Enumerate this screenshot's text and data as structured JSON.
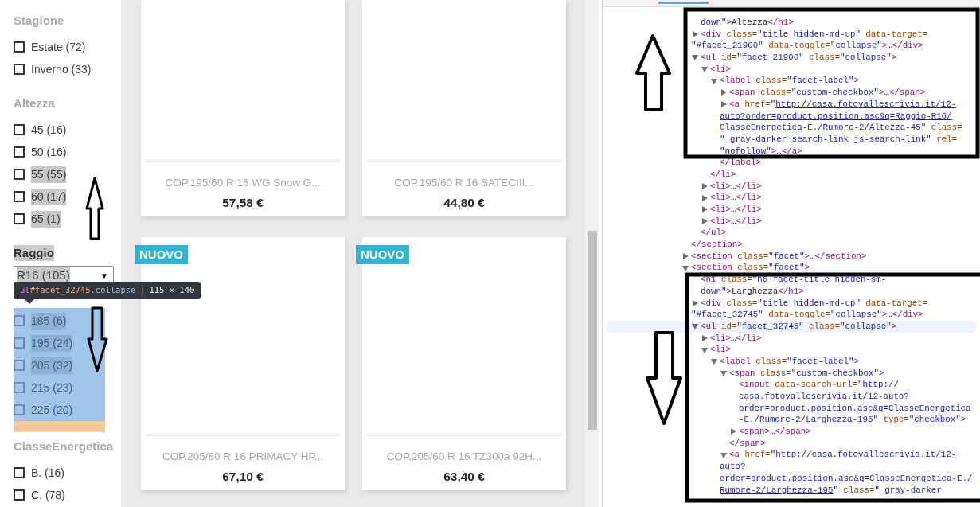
{
  "sidebar": {
    "facets": [
      {
        "kind": "checkbox",
        "title": "Stagione",
        "title_highlighted": false,
        "items": [
          {
            "label": "Estate (72)",
            "checked": false,
            "highlighted": false
          },
          {
            "label": "Inverno (33)",
            "checked": false,
            "highlighted": false
          }
        ]
      },
      {
        "kind": "checkbox",
        "title": "Altezza",
        "title_highlighted": false,
        "items": [
          {
            "label": "45 (16)",
            "checked": false,
            "highlighted": false
          },
          {
            "label": "50 (16)",
            "checked": false,
            "highlighted": false
          },
          {
            "label": "55 (55)",
            "checked": false,
            "highlighted": true
          },
          {
            "label": "60 (17)",
            "checked": false,
            "highlighted": true
          },
          {
            "label": "65 (1)",
            "checked": false,
            "highlighted": true
          }
        ]
      },
      {
        "kind": "select",
        "title": "Raggio",
        "title_highlighted": true,
        "value": "R16 (105)",
        "value_highlighted": true,
        "caret": "▼"
      },
      {
        "kind": "checkbox",
        "inspected": true,
        "tooltip": {
          "tag": "ul",
          "id": "#facet_32745",
          "class": ".collapse",
          "size": "115 × 140"
        },
        "items": [
          {
            "label": "185 (6)",
            "checked": false,
            "highlighted": true
          },
          {
            "label": "195 (24)",
            "checked": false,
            "highlighted": true
          },
          {
            "label": "205 (32)",
            "checked": false,
            "highlighted": true
          },
          {
            "label": "215 (23)",
            "checked": false,
            "highlighted": false
          },
          {
            "label": "225 (20)",
            "checked": false,
            "highlighted": false
          }
        ]
      },
      {
        "kind": "checkbox",
        "title": "ClasseEnergetica",
        "title_highlighted": false,
        "items": [
          {
            "label": "B. (16)",
            "checked": false,
            "highlighted": false
          },
          {
            "label": "C. (78)",
            "checked": false,
            "highlighted": false
          }
        ]
      }
    ]
  },
  "products": [
    {
      "title": "COP.195/60 R 16 WG Snow G...",
      "price": "57,58 €"
    },
    {
      "title": "COP.195/60 R 16 SATECIII...",
      "price": "44,80 €"
    },
    {
      "title": "COP.205/60 R 16 PRIMACY HP...",
      "price": "67,10 €",
      "badge": "NUOVO"
    },
    {
      "title": "COP.205/60 R 16 TZ300a 92H...",
      "price": "63,40 €",
      "badge": "NUOVO"
    }
  ],
  "devtools": {
    "tree": [
      {
        "close": [
          {
            "kind": "tag",
            "text": "</section>"
          }
        ],
        "children": [
          {
            "highlighted": false,
            "lines": [
              [
                {
                  "kind": "val",
                  "text": "down\""
                },
                {
                  "kind": "tag",
                  "text": ">"
                },
                {
                  "kind": "txt",
                  "text": "Altezza"
                },
                {
                  "kind": "tag",
                  "text": "</h1>"
                }
              ]
            ]
          },
          {
            "expanded": false,
            "highlighted": false,
            "lines": [
              [
                {
                  "kind": "tag",
                  "text": "<div"
                },
                {
                  "kind": "attr",
                  "text": " class="
                },
                {
                  "kind": "val",
                  "text": "\"title hidden-md-up\""
                },
                {
                  "kind": "attr",
                  "text": " data-target="
                }
              ],
              [
                {
                  "kind": "val",
                  "text": "\"#facet_21900\""
                },
                {
                  "kind": "attr",
                  "text": " data-toggle="
                },
                {
                  "kind": "val",
                  "text": "\"collapse\""
                },
                {
                  "kind": "tag",
                  "text": ">"
                },
                {
                  "kind": "txt",
                  "text": "…"
                },
                {
                  "kind": "tag",
                  "text": "</div>"
                }
              ]
            ]
          },
          {
            "expanded": true,
            "highlighted": false,
            "lines": [
              [
                {
                  "kind": "tag",
                  "text": "<ul"
                },
                {
                  "kind": "attr",
                  "text": " id="
                },
                {
                  "kind": "val",
                  "text": "\"facet_21900\""
                },
                {
                  "kind": "attr",
                  "text": " class="
                },
                {
                  "kind": "val",
                  "text": "\"collapse\""
                },
                {
                  "kind": "tag",
                  "text": ">"
                }
              ]
            ],
            "close": [
              {
                "kind": "tag",
                "text": "</ul>"
              }
            ],
            "children": [
              {
                "expanded": true,
                "highlighted": false,
                "lines": [
                  [
                    {
                      "kind": "tag",
                      "text": "<li>"
                    }
                  ]
                ],
                "close": [
                  {
                    "kind": "tag",
                    "text": "</li>"
                  }
                ],
                "children": [
                  {
                    "expanded": true,
                    "highlighted": false,
                    "lines": [
                      [
                        {
                          "kind": "tag",
                          "text": "<label"
                        },
                        {
                          "kind": "attr",
                          "text": " class="
                        },
                        {
                          "kind": "val",
                          "text": "\"facet-label\""
                        },
                        {
                          "kind": "tag",
                          "text": ">"
                        }
                      ]
                    ],
                    "close": [
                      {
                        "kind": "tag",
                        "text": "</label>"
                      }
                    ],
                    "children": [
                      {
                        "expanded": false,
                        "highlighted": false,
                        "lines": [
                          [
                            {
                              "kind": "tag",
                              "text": "<span"
                            },
                            {
                              "kind": "attr",
                              "text": " class="
                            },
                            {
                              "kind": "val",
                              "text": "\"custom-checkbox\""
                            },
                            {
                              "kind": "tag",
                              "text": ">"
                            },
                            {
                              "kind": "txt",
                              "text": "…"
                            },
                            {
                              "kind": "tag",
                              "text": "</span>"
                            }
                          ]
                        ]
                      },
                      {
                        "expanded": false,
                        "highlighted": false,
                        "lines": [
                          [
                            {
                              "kind": "tag",
                              "text": "<a"
                            },
                            {
                              "kind": "attr",
                              "text": " href="
                            },
                            {
                              "kind": "val",
                              "text": "\""
                            },
                            {
                              "kind": "link",
                              "text": "http://casa.fotovallescrivia.it/12-"
                            }
                          ],
                          [
                            {
                              "kind": "link",
                              "text": "auto?order=product.position.asc&q=Raggio-R16/"
                            }
                          ],
                          [
                            {
                              "kind": "link",
                              "text": "ClasseEnergetica-E./Rumore-2/Altezza-45"
                            },
                            {
                              "kind": "val",
                              "text": "\""
                            },
                            {
                              "kind": "attr",
                              "text": " class="
                            }
                          ],
                          [
                            {
                              "kind": "val",
                              "text": "\"_gray-darker search-link js-search-link\""
                            },
                            {
                              "kind": "attr",
                              "text": " rel="
                            }
                          ],
                          [
                            {
                              "kind": "val",
                              "text": "\"nofollow\""
                            },
                            {
                              "kind": "tag",
                              "text": ">"
                            },
                            {
                              "kind": "txt",
                              "text": "…"
                            },
                            {
                              "kind": "tag",
                              "text": "</a>"
                            }
                          ]
                        ]
                      }
                    ]
                  }
                ]
              },
              {
                "expanded": false,
                "highlighted": false,
                "lines": [
                  [
                    {
                      "kind": "tag",
                      "text": "<li>"
                    },
                    {
                      "kind": "txt",
                      "text": "…"
                    },
                    {
                      "kind": "tag",
                      "text": "</li>"
                    }
                  ]
                ]
              },
              {
                "expanded": false,
                "highlighted": false,
                "lines": [
                  [
                    {
                      "kind": "tag",
                      "text": "<li>"
                    },
                    {
                      "kind": "txt",
                      "text": "…"
                    },
                    {
                      "kind": "tag",
                      "text": "</li>"
                    }
                  ]
                ]
              },
              {
                "expanded": false,
                "highlighted": false,
                "lines": [
                  [
                    {
                      "kind": "tag",
                      "text": "<li>"
                    },
                    {
                      "kind": "txt",
                      "text": "…"
                    },
                    {
                      "kind": "tag",
                      "text": "</li>"
                    }
                  ]
                ]
              },
              {
                "expanded": false,
                "highlighted": false,
                "lines": [
                  [
                    {
                      "kind": "tag",
                      "text": "<li>"
                    },
                    {
                      "kind": "txt",
                      "text": "…"
                    },
                    {
                      "kind": "tag",
                      "text": "</li>"
                    }
                  ]
                ]
              }
            ]
          }
        ]
      },
      {
        "expanded": false,
        "highlighted": false,
        "lines": [
          [
            {
              "kind": "tag",
              "text": "<section"
            },
            {
              "kind": "attr",
              "text": " class="
            },
            {
              "kind": "val",
              "text": "\"facet\""
            },
            {
              "kind": "tag",
              "text": ">"
            },
            {
              "kind": "txt",
              "text": "…"
            },
            {
              "kind": "tag",
              "text": "</section>"
            }
          ]
        ]
      },
      {
        "expanded": true,
        "highlighted": false,
        "lines": [
          [
            {
              "kind": "tag",
              "text": "<section"
            },
            {
              "kind": "attr",
              "text": " class="
            },
            {
              "kind": "val",
              "text": "\"facet\""
            },
            {
              "kind": "tag",
              "text": ">"
            }
          ]
        ],
        "children": [
          {
            "highlighted": false,
            "lines": [
              [
                {
                  "kind": "tag",
                  "text": "<h1"
                },
                {
                  "kind": "attr",
                  "text": " class="
                },
                {
                  "kind": "val",
                  "text": "\"h6 facet-title hidden-sm-"
                }
              ],
              [
                {
                  "kind": "val",
                  "text": "down\""
                },
                {
                  "kind": "tag",
                  "text": ">"
                },
                {
                  "kind": "txt",
                  "text": "Larghezza"
                },
                {
                  "kind": "tag",
                  "text": "</h1>"
                }
              ]
            ]
          },
          {
            "expanded": false,
            "highlighted": false,
            "lines": [
              [
                {
                  "kind": "tag",
                  "text": "<div"
                },
                {
                  "kind": "attr",
                  "text": " class="
                },
                {
                  "kind": "val",
                  "text": "\"title hidden-md-up\""
                },
                {
                  "kind": "attr",
                  "text": " data-target="
                }
              ],
              [
                {
                  "kind": "val",
                  "text": "\"#facet_32745\""
                },
                {
                  "kind": "attr",
                  "text": " data-toggle="
                },
                {
                  "kind": "val",
                  "text": "\"collapse\""
                },
                {
                  "kind": "tag",
                  "text": ">"
                },
                {
                  "kind": "txt",
                  "text": "…"
                },
                {
                  "kind": "tag",
                  "text": "</div>"
                }
              ]
            ]
          },
          {
            "expanded": true,
            "highlighted": true,
            "lines": [
              [
                {
                  "kind": "tag",
                  "text": "<ul"
                },
                {
                  "kind": "attr",
                  "text": " id="
                },
                {
                  "kind": "val",
                  "text": "\"facet_32745\""
                },
                {
                  "kind": "attr",
                  "text": " class="
                },
                {
                  "kind": "val",
                  "text": "\"collapse\""
                },
                {
                  "kind": "tag",
                  "text": ">"
                }
              ]
            ],
            "children": [
              {
                "expanded": false,
                "highlighted": false,
                "lines": [
                  [
                    {
                      "kind": "tag",
                      "text": "<li>"
                    },
                    {
                      "kind": "txt",
                      "text": "…"
                    },
                    {
                      "kind": "tag",
                      "text": "</li>"
                    }
                  ]
                ]
              },
              {
                "expanded": true,
                "highlighted": false,
                "lines": [
                  [
                    {
                      "kind": "tag",
                      "text": "<li>"
                    }
                  ]
                ],
                "children": [
                  {
                    "expanded": true,
                    "highlighted": false,
                    "lines": [
                      [
                        {
                          "kind": "tag",
                          "text": "<label"
                        },
                        {
                          "kind": "attr",
                          "text": " class="
                        },
                        {
                          "kind": "val",
                          "text": "\"facet-label\""
                        },
                        {
                          "kind": "tag",
                          "text": ">"
                        }
                      ]
                    ],
                    "children": [
                      {
                        "expanded": true,
                        "highlighted": false,
                        "lines": [
                          [
                            {
                              "kind": "tag",
                              "text": "<span"
                            },
                            {
                              "kind": "attr",
                              "text": " class="
                            },
                            {
                              "kind": "val",
                              "text": "\"custom-checkbox\""
                            },
                            {
                              "kind": "tag",
                              "text": ">"
                            }
                          ]
                        ],
                        "close": [
                          {
                            "kind": "tag",
                            "text": "</span>"
                          }
                        ],
                        "children": [
                          {
                            "highlighted": false,
                            "lines": [
                              [
                                {
                                  "kind": "tag",
                                  "text": "<input"
                                },
                                {
                                  "kind": "attr",
                                  "text": " data-search-url="
                                },
                                {
                                  "kind": "val",
                                  "text": "\"http://"
                                }
                              ],
                              [
                                {
                                  "kind": "val",
                                  "text": "casa.fotovallescrivia.it/12-auto?"
                                }
                              ],
                              [
                                {
                                  "kind": "val",
                                  "text": "order=product.position.asc&q=ClasseEnergetica"
                                }
                              ],
                              [
                                {
                                  "kind": "val",
                                  "text": "-E./Rumore-2/Larghezza-195\""
                                },
                                {
                                  "kind": "attr",
                                  "text": " type="
                                },
                                {
                                  "kind": "val",
                                  "text": "\"checkbox\""
                                },
                                {
                                  "kind": "tag",
                                  "text": ">"
                                }
                              ]
                            ]
                          },
                          {
                            "expanded": false,
                            "highlighted": false,
                            "lines": [
                              [
                                {
                                  "kind": "tag",
                                  "text": "<span>"
                                },
                                {
                                  "kind": "txt",
                                  "text": "…"
                                },
                                {
                                  "kind": "tag",
                                  "text": "</span>"
                                }
                              ]
                            ]
                          }
                        ]
                      },
                      {
                        "expanded": true,
                        "highlighted": false,
                        "lines": [
                          [
                            {
                              "kind": "tag",
                              "text": "<a"
                            },
                            {
                              "kind": "attr",
                              "text": " href="
                            },
                            {
                              "kind": "val",
                              "text": "\""
                            },
                            {
                              "kind": "link",
                              "text": "http://casa.fotovallescrivia.it/12-"
                            }
                          ],
                          [
                            {
                              "kind": "link",
                              "text": "auto?"
                            }
                          ],
                          [
                            {
                              "kind": "link",
                              "text": "order=product.position.asc&q=ClasseEnergetica-E./"
                            }
                          ],
                          [
                            {
                              "kind": "link",
                              "text": "Rumore-2/Larghezza-195"
                            },
                            {
                              "kind": "val",
                              "text": "\""
                            },
                            {
                              "kind": "attr",
                              "text": " class="
                            },
                            {
                              "kind": "val",
                              "text": "\"_gray-darker"
                            }
                          ]
                        ]
                      }
                    ]
                  }
                ]
              }
            ]
          }
        ]
      }
    ]
  },
  "markup": [
    {
      "kind": "frame"
    },
    {
      "kind": "frame"
    },
    {
      "kind": "up_arrow"
    },
    {
      "kind": "down_arrow"
    },
    {
      "kind": "up_arrow"
    },
    {
      "kind": "down_arrow"
    }
  ]
}
